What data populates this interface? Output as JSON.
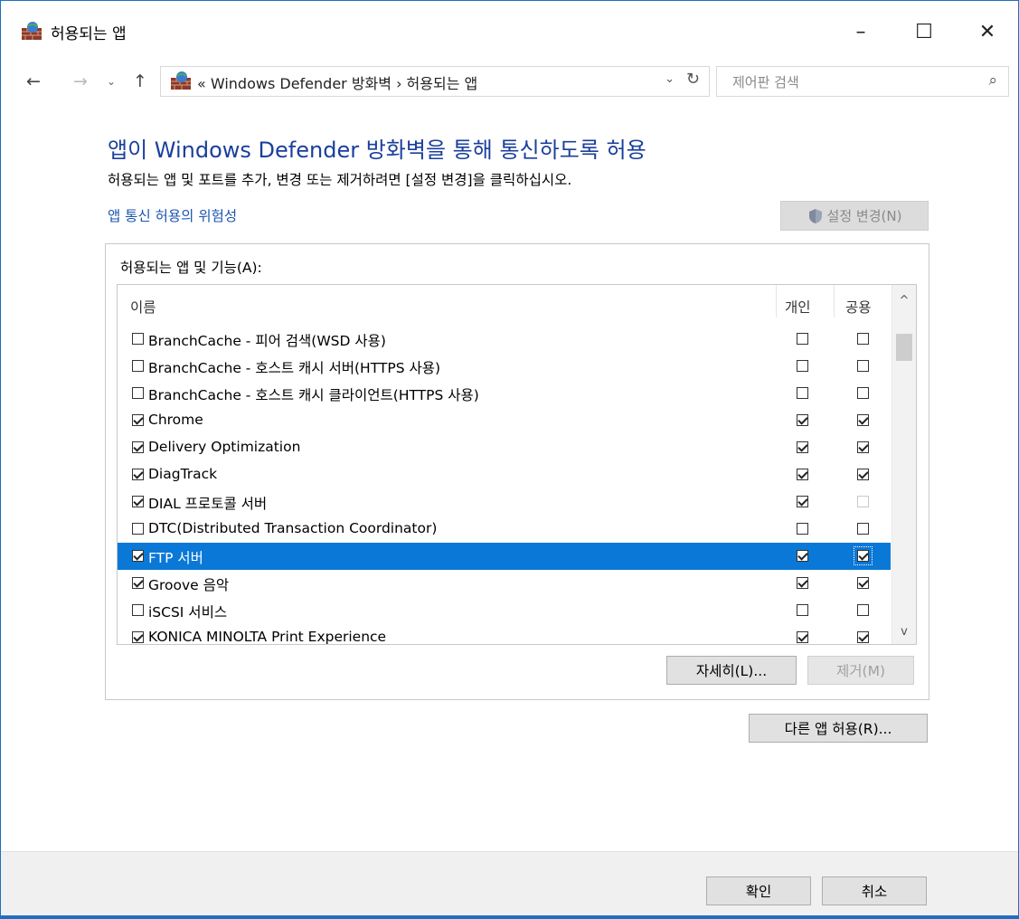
{
  "window": {
    "title": "허용되는 앱",
    "controls": {
      "minimize": "–",
      "maximize": "☐",
      "close": "✕"
    }
  },
  "nav": {
    "back": "←",
    "forward": "→",
    "recent": "⌄",
    "up": "↑",
    "address": "« Windows Defender 방화벽 › 허용되는 앱",
    "dropdown": "⌄",
    "refresh": "↻",
    "search_placeholder": "제어판 검색",
    "search_icon": "⌕"
  },
  "content": {
    "heading": "앱이 Windows Defender 방화벽을 통해 통신하도록 허용",
    "subtitle": "허용되는 앱 및 포트를 추가, 변경 또는 제거하려면 [설정 변경]을 클릭하십시오.",
    "risk_link": "앱 통신 허용의 위험성",
    "change_settings": "설정 변경(N)"
  },
  "group": {
    "label": "허용되는 앱 및 기능(A):",
    "columns": {
      "name": "이름",
      "private": "개인",
      "public": "공용"
    },
    "rows": [
      {
        "name": "BranchCache - 피어 검색(WSD 사용)",
        "enabled": false,
        "private": false,
        "public": false
      },
      {
        "name": "BranchCache - 호스트 캐시 서버(HTTPS 사용)",
        "enabled": false,
        "private": false,
        "public": false
      },
      {
        "name": "BranchCache - 호스트 캐시 클라이언트(HTTPS 사용)",
        "enabled": false,
        "private": false,
        "public": false
      },
      {
        "name": "Chrome",
        "enabled": true,
        "private": true,
        "public": true
      },
      {
        "name": "Delivery Optimization",
        "enabled": true,
        "private": true,
        "public": true
      },
      {
        "name": "DiagTrack",
        "enabled": true,
        "private": true,
        "public": true
      },
      {
        "name": "DIAL 프로토콜 서버",
        "enabled": true,
        "private": true,
        "public": false
      },
      {
        "name": "DTC(Distributed Transaction Coordinator)",
        "enabled": false,
        "private": false,
        "public": false
      },
      {
        "name": "FTP 서버",
        "enabled": true,
        "private": true,
        "public": true,
        "selected": true
      },
      {
        "name": "Groove 음악",
        "enabled": true,
        "private": true,
        "public": true
      },
      {
        "name": "iSCSI 서비스",
        "enabled": false,
        "private": false,
        "public": false
      },
      {
        "name": "KONICA MINOLTA Print Experience",
        "enabled": true,
        "private": true,
        "public": true
      }
    ],
    "details_button": "자세히(L)...",
    "remove_button": "제거(M)"
  },
  "allow_other_button": "다른 앱 허용(R)...",
  "footer": {
    "ok": "확인",
    "cancel": "취소"
  },
  "colors": {
    "heading": "#1a3f9c",
    "link": "#1a56b0",
    "selection": "#0a78d7",
    "border": "#1e6fc2"
  },
  "icons": [
    "firewall-icon",
    "shield-icon",
    "search-icon",
    "refresh-icon",
    "back-arrow-icon",
    "forward-arrow-icon",
    "up-arrow-icon",
    "chevron-down-icon",
    "chevron-up-icon"
  ]
}
